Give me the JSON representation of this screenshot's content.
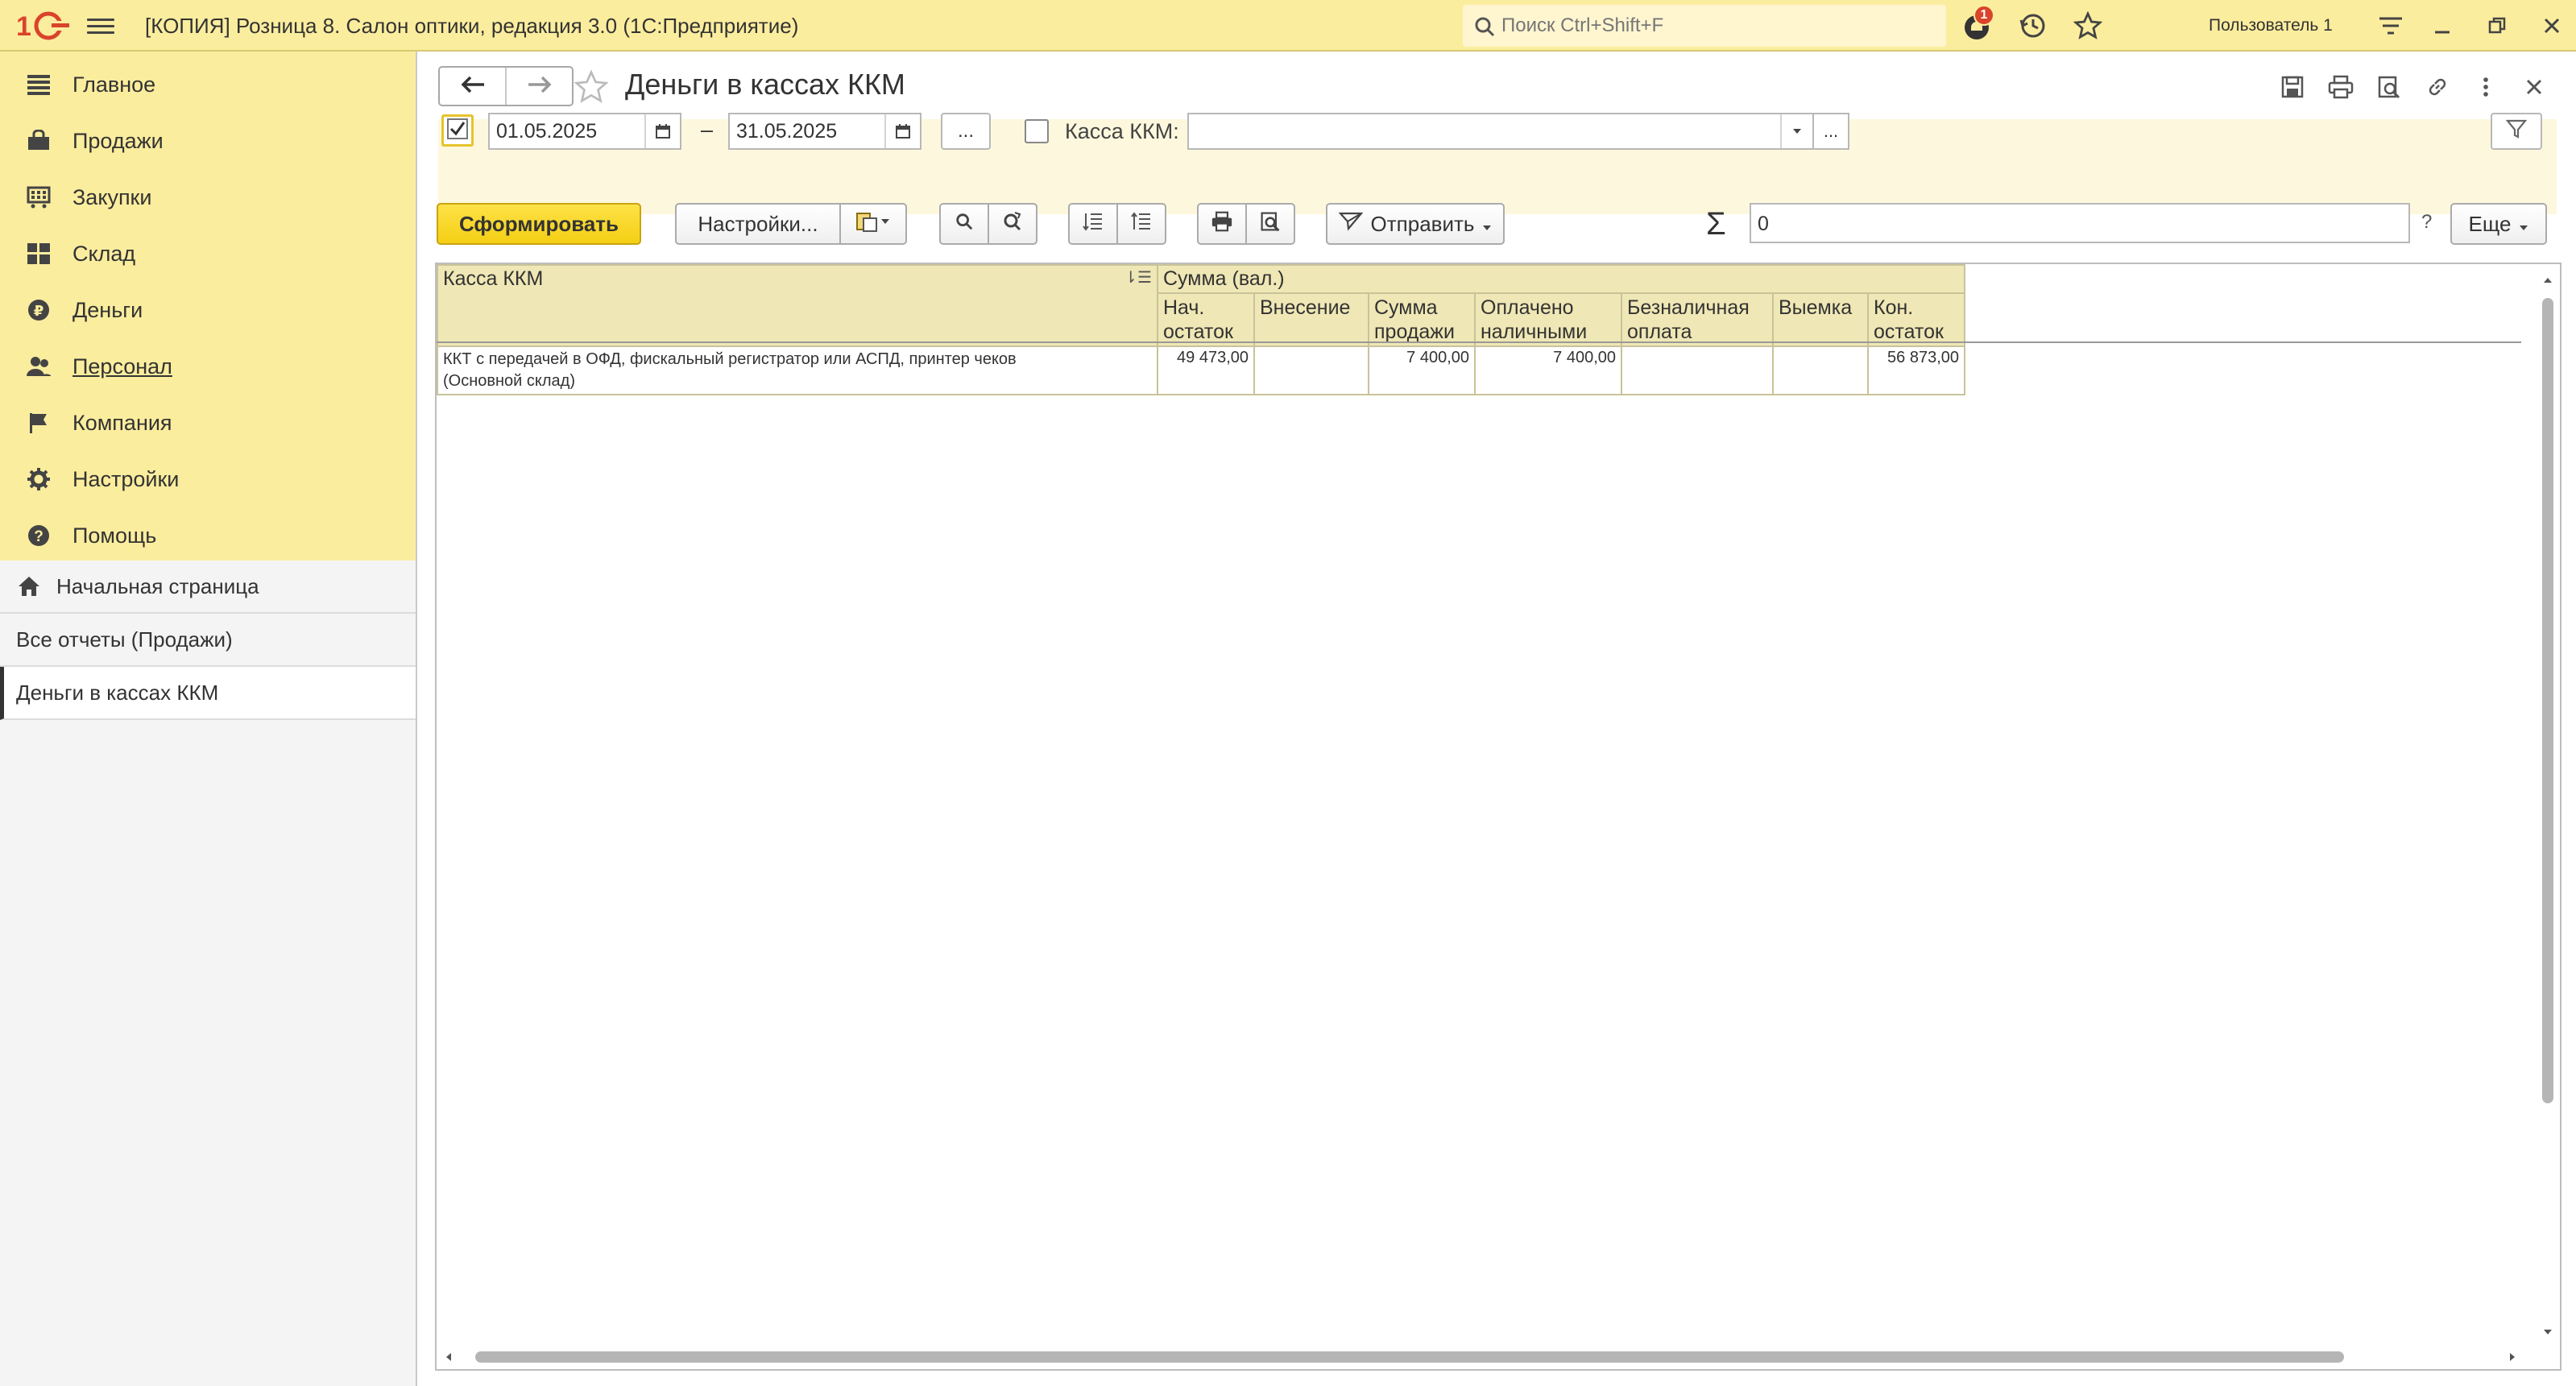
{
  "topbar": {
    "title": "[КОПИЯ] Розница 8. Салон оптики, редакция 3.0  (1С:Предприятие)",
    "search_placeholder": "Поиск Ctrl+Shift+F",
    "notifications_count": "1",
    "user": "Пользователь 1",
    "accent_color": "#fbed9e"
  },
  "sidebar": {
    "sections": [
      {
        "label": "Главное",
        "icon": "list-icon"
      },
      {
        "label": "Продажи",
        "icon": "cart-icon"
      },
      {
        "label": "Закупки",
        "icon": "purchase-icon"
      },
      {
        "label": "Склад",
        "icon": "warehouse-icon"
      },
      {
        "label": "Деньги",
        "icon": "ruble-icon"
      },
      {
        "label": "Персонал",
        "icon": "people-icon"
      },
      {
        "label": "Компания",
        "icon": "flag-icon"
      },
      {
        "label": "Настройки",
        "icon": "gear-icon"
      },
      {
        "label": "Помощь",
        "icon": "help-icon"
      }
    ],
    "open_windows": [
      {
        "label": "Начальная страница",
        "icon": "home-icon"
      },
      {
        "label": "Все отчеты (Продажи)"
      },
      {
        "label": "Деньги в кассах ККМ",
        "active": true
      }
    ]
  },
  "form": {
    "title": "Деньги в кассах ККМ",
    "date_from": "01.05.2025",
    "date_to": "31.05.2025",
    "period_dash": "–",
    "period_more": "...",
    "kassa_label": "Касса ККМ:",
    "kassa_value": "",
    "kassa_more": "...",
    "generate_label": "Сформировать",
    "settings_label": "Настройки...",
    "send_label": "Отправить",
    "sigma": "Σ",
    "sum_value": "0",
    "help_mark": "?",
    "more_label": "Еще"
  },
  "report": {
    "header": {
      "kassa_col": "Касса ККМ",
      "group": "Сумма (вал.)",
      "columns": [
        "Нач. остаток",
        "Внесение",
        "Сумма продажи",
        "Оплачено наличными",
        "Безналичная оплата",
        "Выемка",
        "Кон. остаток"
      ]
    },
    "rows": [
      {
        "name_line1": "ККТ с передачей в ОФД, фискальный регистратор или АСПД, принтер чеков",
        "name_line2": "(Основной склад)",
        "values": [
          "49 473,00",
          "",
          "7 400,00",
          "7 400,00",
          "",
          "",
          "56 873,00"
        ]
      }
    ]
  }
}
